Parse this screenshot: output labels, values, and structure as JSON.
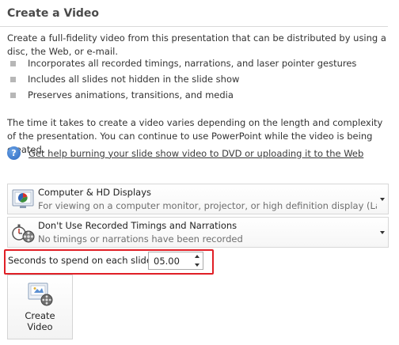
{
  "section": {
    "title": "Create a Video",
    "description": "Create a full-fidelity video from this presentation that can be distributed by using a disc, the Web, or e-mail.",
    "bullets": [
      "Incorporates all recorded timings, narrations, and laser pointer gestures",
      "Includes all slides not hidden in the slide show",
      "Preserves animations, transitions, and media"
    ],
    "note": "The time it takes to create a video varies depending on the length and complexity of the presentation. You can continue to use PowerPoint while the video is being created.",
    "help_link": "Get help burning your slide show video to DVD or uploading it to the Web"
  },
  "quality_dropdown": {
    "title": "Computer & HD Displays",
    "subtitle": "For viewing on a computer monitor, projector, or high definition display  (Larg...",
    "icon": "monitor-chart-icon"
  },
  "timings_dropdown": {
    "title": "Don't Use Recorded Timings and Narrations",
    "subtitle": "No timings or narrations have been recorded",
    "icon": "stopwatch-film-icon"
  },
  "seconds": {
    "label": "Seconds to spend on each slide:",
    "value": "05.00"
  },
  "create_button": {
    "label": "Create Video",
    "icon": "create-video-icon"
  },
  "colors": {
    "highlight": "#e01f26",
    "help_icon": "#2d68bf"
  }
}
